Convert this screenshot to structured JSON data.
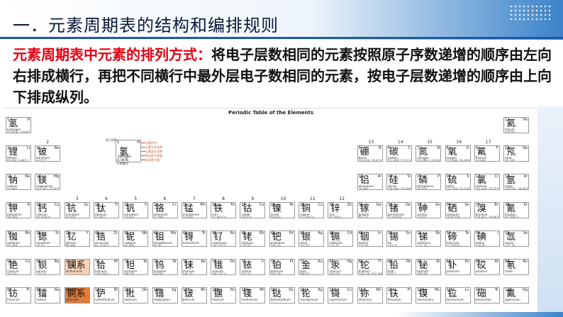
{
  "header": {
    "title": "一．元素周期表的结构和编排规则"
  },
  "description": {
    "highlight": "元素周期表中元素的排列方式：",
    "text": "将电子层数相同的元素按照原子序数递增的顺序由左向右排成横行，再把不同横行中最外层电子数相同的元素，按电子层数递增的顺序由上向下排成纵列。"
  },
  "table": {
    "title": "Periodic Table of the Elements",
    "legend": {
      "label": "原子序数",
      "lines": [
        "元素符号",
        "元素中文名称",
        "元素英文名称",
        "相对原子质量",
        "标准原子量"
      ],
      "sample": {
        "z": "1",
        "s": "H",
        "c": "氢",
        "n": "hydrogen",
        "m": "[1.0078, 1.0082]"
      }
    },
    "group_labels": [
      {
        "text": "1",
        "col": 1,
        "row": 0
      },
      {
        "text": "2",
        "col": 2,
        "row": 1
      },
      {
        "text": "3",
        "col": 3,
        "row": 3
      },
      {
        "text": "4",
        "col": 4,
        "row": 3
      },
      {
        "text": "5",
        "col": 5,
        "row": 3
      },
      {
        "text": "6",
        "col": 6,
        "row": 3
      },
      {
        "text": "7",
        "col": 7,
        "row": 3
      },
      {
        "text": "8",
        "col": 8,
        "row": 3
      },
      {
        "text": "9",
        "col": 9,
        "row": 3
      },
      {
        "text": "10",
        "col": 10,
        "row": 3
      },
      {
        "text": "11",
        "col": 11,
        "row": 3
      },
      {
        "text": "12",
        "col": 12,
        "row": 3
      },
      {
        "text": "13",
        "col": 13,
        "row": 1
      },
      {
        "text": "14",
        "col": 14,
        "row": 1
      },
      {
        "text": "15",
        "col": 15,
        "row": 1
      },
      {
        "text": "16",
        "col": 16,
        "row": 1
      },
      {
        "text": "17",
        "col": 17,
        "row": 1
      },
      {
        "text": "18",
        "col": 18,
        "row": 0
      }
    ],
    "elements": [
      {
        "z": "1",
        "s": "H",
        "c": "氢",
        "n": "hydrogen",
        "m": "[1.0078, 1.0082]",
        "col": 1,
        "row": 1
      },
      {
        "z": "2",
        "s": "He",
        "c": "氦",
        "n": "helium",
        "m": "4.0026",
        "col": 18,
        "row": 1
      },
      {
        "z": "3",
        "s": "Li",
        "c": "锂",
        "n": "lithium",
        "m": "[6.938, 6.997]",
        "col": 1,
        "row": 2
      },
      {
        "z": "4",
        "s": "Be",
        "c": "铍",
        "n": "beryllium",
        "m": "9.0122",
        "col": 2,
        "row": 2
      },
      {
        "z": "5",
        "s": "B",
        "c": "硼",
        "n": "boron",
        "m": "[10.806, 10.821]",
        "col": 13,
        "row": 2
      },
      {
        "z": "6",
        "s": "C",
        "c": "碳",
        "n": "carbon",
        "m": "[12.009, 12.012]",
        "col": 14,
        "row": 2
      },
      {
        "z": "7",
        "s": "N",
        "c": "氮",
        "n": "nitrogen",
        "m": "[14.006, 14.008]",
        "col": 15,
        "row": 2
      },
      {
        "z": "8",
        "s": "O",
        "c": "氧",
        "n": "oxygen",
        "m": "[15.999, 16.000]",
        "col": 16,
        "row": 2
      },
      {
        "z": "9",
        "s": "F",
        "c": "氟",
        "n": "fluorine",
        "m": "18.998",
        "col": 17,
        "row": 2
      },
      {
        "z": "10",
        "s": "Ne",
        "c": "氖",
        "n": "neon",
        "m": "20.180",
        "col": 18,
        "row": 2
      },
      {
        "z": "11",
        "s": "Na",
        "c": "钠",
        "n": "sodium",
        "m": "22.990",
        "col": 1,
        "row": 3
      },
      {
        "z": "12",
        "s": "Mg",
        "c": "镁",
        "n": "magnesium",
        "m": "[24.304, 24.307]",
        "col": 2,
        "row": 3
      },
      {
        "z": "13",
        "s": "Al",
        "c": "铝",
        "n": "aluminium",
        "m": "26.982",
        "col": 13,
        "row": 3
      },
      {
        "z": "14",
        "s": "Si",
        "c": "硅",
        "n": "silicon",
        "m": "[28.084, 28.086]",
        "col": 14,
        "row": 3
      },
      {
        "z": "15",
        "s": "P",
        "c": "磷",
        "n": "phosphorus",
        "m": "30.974",
        "col": 15,
        "row": 3
      },
      {
        "z": "16",
        "s": "S",
        "c": "硫",
        "n": "sulfur",
        "m": "[32.059, 32.076]",
        "col": 16,
        "row": 3
      },
      {
        "z": "17",
        "s": "Cl",
        "c": "氯",
        "n": "chlorine",
        "m": "[35.446, 35.457]",
        "col": 17,
        "row": 3
      },
      {
        "z": "18",
        "s": "Ar",
        "c": "氩",
        "n": "argon",
        "m": "[39.792, 39.963]",
        "col": 18,
        "row": 3
      },
      {
        "z": "19",
        "s": "K",
        "c": "钾",
        "n": "potassium",
        "m": "39.098",
        "col": 1,
        "row": 4
      },
      {
        "z": "20",
        "s": "Ca",
        "c": "钙",
        "n": "calcium",
        "m": "40.078(4)",
        "col": 2,
        "row": 4
      },
      {
        "z": "21",
        "s": "Sc",
        "c": "钪",
        "n": "scandium",
        "m": "44.956",
        "col": 3,
        "row": 4
      },
      {
        "z": "22",
        "s": "Ti",
        "c": "钛",
        "n": "titanium",
        "m": "47.867",
        "col": 4,
        "row": 4
      },
      {
        "z": "23",
        "s": "V",
        "c": "钒",
        "n": "vanadium",
        "m": "50.942",
        "col": 5,
        "row": 4
      },
      {
        "z": "24",
        "s": "Cr",
        "c": "铬",
        "n": "chromium",
        "m": "51.996",
        "col": 6,
        "row": 4
      },
      {
        "z": "25",
        "s": "Mn",
        "c": "锰",
        "n": "manganese",
        "m": "54.938",
        "col": 7,
        "row": 4
      },
      {
        "z": "26",
        "s": "Fe",
        "c": "铁",
        "n": "iron",
        "m": "55.845(2)",
        "col": 8,
        "row": 4
      },
      {
        "z": "27",
        "s": "Co",
        "c": "钴",
        "n": "cobalt",
        "m": "58.933",
        "col": 9,
        "row": 4
      },
      {
        "z": "28",
        "s": "Ni",
        "c": "镍",
        "n": "nickel",
        "m": "58.693",
        "col": 10,
        "row": 4
      },
      {
        "z": "29",
        "s": "Cu",
        "c": "铜",
        "n": "copper",
        "m": "63.546(3)",
        "col": 11,
        "row": 4
      },
      {
        "z": "30",
        "s": "Zn",
        "c": "锌",
        "n": "zinc",
        "m": "65.38(2)",
        "col": 12,
        "row": 4
      },
      {
        "z": "31",
        "s": "Ga",
        "c": "镓",
        "n": "gallium",
        "m": "69.723",
        "col": 13,
        "row": 4
      },
      {
        "z": "32",
        "s": "Ge",
        "c": "锗",
        "n": "germanium",
        "m": "72.630(8)",
        "col": 14,
        "row": 4
      },
      {
        "z": "33",
        "s": "As",
        "c": "砷",
        "n": "arsenic",
        "m": "74.922",
        "col": 15,
        "row": 4
      },
      {
        "z": "34",
        "s": "Se",
        "c": "硒",
        "n": "selenium",
        "m": "78.971(8)",
        "col": 16,
        "row": 4
      },
      {
        "z": "35",
        "s": "Br",
        "c": "溴",
        "n": "bromine",
        "m": "[79.901, 79.907]",
        "col": 17,
        "row": 4
      },
      {
        "z": "36",
        "s": "Kr",
        "c": "氪",
        "n": "krypton",
        "m": "83.798(2)",
        "col": 18,
        "row": 4
      },
      {
        "z": "37",
        "s": "Rb",
        "c": "铷",
        "n": "rubidium",
        "m": "85.468",
        "col": 1,
        "row": 5
      },
      {
        "z": "38",
        "s": "Sr",
        "c": "锶",
        "n": "strontium",
        "m": "87.62",
        "col": 2,
        "row": 5
      },
      {
        "z": "39",
        "s": "Y",
        "c": "钇",
        "n": "yttrium",
        "m": "88.906",
        "col": 3,
        "row": 5
      },
      {
        "z": "40",
        "s": "Zr",
        "c": "锆",
        "n": "zirconium",
        "m": "91.224(2)",
        "col": 4,
        "row": 5
      },
      {
        "z": "41",
        "s": "Nb",
        "c": "铌",
        "n": "niobium",
        "m": "92.906",
        "col": 5,
        "row": 5
      },
      {
        "z": "42",
        "s": "Mo",
        "c": "钼",
        "n": "molybdenum",
        "m": "95.95",
        "col": 6,
        "row": 5
      },
      {
        "z": "43",
        "s": "Tc",
        "c": "锝",
        "n": "technetium",
        "m": "",
        "col": 7,
        "row": 5
      },
      {
        "z": "44",
        "s": "Ru",
        "c": "钌",
        "n": "ruthenium",
        "m": "101.07(2)",
        "col": 8,
        "row": 5
      },
      {
        "z": "45",
        "s": "Rh",
        "c": "铑",
        "n": "rhodium",
        "m": "102.91",
        "col": 9,
        "row": 5
      },
      {
        "z": "46",
        "s": "Pd",
        "c": "钯",
        "n": "palladium",
        "m": "106.42",
        "col": 10,
        "row": 5
      },
      {
        "z": "47",
        "s": "Ag",
        "c": "银",
        "n": "silver",
        "m": "107.87",
        "col": 11,
        "row": 5
      },
      {
        "z": "48",
        "s": "Cd",
        "c": "镉",
        "n": "cadmium",
        "m": "112.41",
        "col": 12,
        "row": 5
      },
      {
        "z": "49",
        "s": "In",
        "c": "铟",
        "n": "indium",
        "m": "114.82",
        "col": 13,
        "row": 5
      },
      {
        "z": "50",
        "s": "Sn",
        "c": "锡",
        "n": "tin",
        "m": "118.71",
        "col": 14,
        "row": 5
      },
      {
        "z": "51",
        "s": "Sb",
        "c": "锑",
        "n": "antimony",
        "m": "121.76",
        "col": 15,
        "row": 5
      },
      {
        "z": "52",
        "s": "Te",
        "c": "碲",
        "n": "tellurium",
        "m": "127.60(3)",
        "col": 16,
        "row": 5
      },
      {
        "z": "53",
        "s": "I",
        "c": "碘",
        "n": "iodine",
        "m": "126.90",
        "col": 17,
        "row": 5
      },
      {
        "z": "54",
        "s": "Xe",
        "c": "氙",
        "n": "xenon",
        "m": "131.29",
        "col": 18,
        "row": 5
      },
      {
        "z": "55",
        "s": "Cs",
        "c": "铯",
        "n": "caesium",
        "m": "132.91",
        "col": 1,
        "row": 6
      },
      {
        "z": "56",
        "s": "Ba",
        "c": "钡",
        "n": "barium",
        "m": "137.33",
        "col": 2,
        "row": 6
      },
      {
        "z": "57-71",
        "s": "",
        "c": "镧系",
        "n": "lanthanoids",
        "m": "",
        "col": 3,
        "row": 6,
        "cls": "lan"
      },
      {
        "z": "72",
        "s": "Hf",
        "c": "铪",
        "n": "hafnium",
        "m": "178.49(2)",
        "col": 4,
        "row": 6
      },
      {
        "z": "73",
        "s": "Ta",
        "c": "钽",
        "n": "tantalum",
        "m": "180.95",
        "col": 5,
        "row": 6
      },
      {
        "z": "74",
        "s": "W",
        "c": "钨",
        "n": "tungsten",
        "m": "183.84",
        "col": 6,
        "row": 6
      },
      {
        "z": "75",
        "s": "Re",
        "c": "铼",
        "n": "rhenium",
        "m": "186.21",
        "col": 7,
        "row": 6
      },
      {
        "z": "76",
        "s": "Os",
        "c": "锇",
        "n": "osmium",
        "m": "190.23(3)",
        "col": 8,
        "row": 6
      },
      {
        "z": "77",
        "s": "Ir",
        "c": "铱",
        "n": "iridium",
        "m": "192.22",
        "col": 9,
        "row": 6
      },
      {
        "z": "78",
        "s": "Pt",
        "c": "铂",
        "n": "platinum",
        "m": "195.08",
        "col": 10,
        "row": 6
      },
      {
        "z": "79",
        "s": "Au",
        "c": "金",
        "n": "gold",
        "m": "196.97",
        "col": 11,
        "row": 6
      },
      {
        "z": "80",
        "s": "Hg",
        "c": "汞",
        "n": "mercury",
        "m": "200.59",
        "col": 12,
        "row": 6
      },
      {
        "z": "81",
        "s": "Tl",
        "c": "铊",
        "n": "thallium",
        "m": "[204.38, 204.39]",
        "col": 13,
        "row": 6
      },
      {
        "z": "82",
        "s": "Pb",
        "c": "铅",
        "n": "lead",
        "m": "207.2",
        "col": 14,
        "row": 6
      },
      {
        "z": "83",
        "s": "Bi",
        "c": "铋",
        "n": "bismuth",
        "m": "208.98",
        "col": 15,
        "row": 6
      },
      {
        "z": "84",
        "s": "Po",
        "c": "钋",
        "n": "polonium",
        "m": "",
        "col": 16,
        "row": 6
      },
      {
        "z": "85",
        "s": "At",
        "c": "砹",
        "n": "astatine",
        "m": "",
        "col": 17,
        "row": 6
      },
      {
        "z": "86",
        "s": "Rn",
        "c": "氡",
        "n": "radon",
        "m": "",
        "col": 18,
        "row": 6
      },
      {
        "z": "87",
        "s": "Fr",
        "c": "钫",
        "n": "francium",
        "m": "",
        "col": 1,
        "row": 7
      },
      {
        "z": "88",
        "s": "Ra",
        "c": "镭",
        "n": "radium",
        "m": "",
        "col": 2,
        "row": 7
      },
      {
        "z": "89-103",
        "s": "",
        "c": "锕系",
        "n": "actinoids",
        "m": "",
        "col": 3,
        "row": 7,
        "cls": "act"
      },
      {
        "z": "104",
        "s": "Rf",
        "c": "𬬻",
        "n": "rutherfordium",
        "m": "",
        "col": 4,
        "row": 7
      },
      {
        "z": "105",
        "s": "Db",
        "c": "𬭊",
        "n": "dubnium",
        "m": "",
        "col": 5,
        "row": 7
      },
      {
        "z": "106",
        "s": "Sg",
        "c": "𬭳",
        "n": "seaborgium",
        "m": "",
        "col": 6,
        "row": 7
      },
      {
        "z": "107",
        "s": "Bh",
        "c": "𬭛",
        "n": "bohrium",
        "m": "",
        "col": 7,
        "row": 7
      },
      {
        "z": "108",
        "s": "Hs",
        "c": "𬭶",
        "n": "hassium",
        "m": "",
        "col": 8,
        "row": 7
      },
      {
        "z": "109",
        "s": "Mt",
        "c": "鿏",
        "n": "meitnerium",
        "m": "",
        "col": 9,
        "row": 7
      },
      {
        "z": "110",
        "s": "Ds",
        "c": "𫟼",
        "n": "darmstadtium",
        "m": "",
        "col": 10,
        "row": 7
      },
      {
        "z": "111",
        "s": "Rg",
        "c": "𬬭",
        "n": "roentgenium",
        "m": "",
        "col": 11,
        "row": 7
      },
      {
        "z": "112",
        "s": "Cn",
        "c": "鿔",
        "n": "copernicium",
        "m": "",
        "col": 12,
        "row": 7
      },
      {
        "z": "113",
        "s": "Nh",
        "c": "鿭",
        "n": "nihonium",
        "m": "",
        "col": 13,
        "row": 7
      },
      {
        "z": "114",
        "s": "Fl",
        "c": "𫓧",
        "n": "flerovium",
        "m": "",
        "col": 14,
        "row": 7
      },
      {
        "z": "115",
        "s": "Mc",
        "c": "镆",
        "n": "moscovium",
        "m": "",
        "col": 15,
        "row": 7
      },
      {
        "z": "116",
        "s": "Lv",
        "c": "𫟷",
        "n": "livermorium",
        "m": "",
        "col": 16,
        "row": 7
      },
      {
        "z": "117",
        "s": "Ts",
        "c": "鿬",
        "n": "tennessine",
        "m": "",
        "col": 17,
        "row": 7
      },
      {
        "z": "118",
        "s": "Og",
        "c": "鿫",
        "n": "oganesson",
        "m": "",
        "col": 18,
        "row": 7
      }
    ]
  }
}
